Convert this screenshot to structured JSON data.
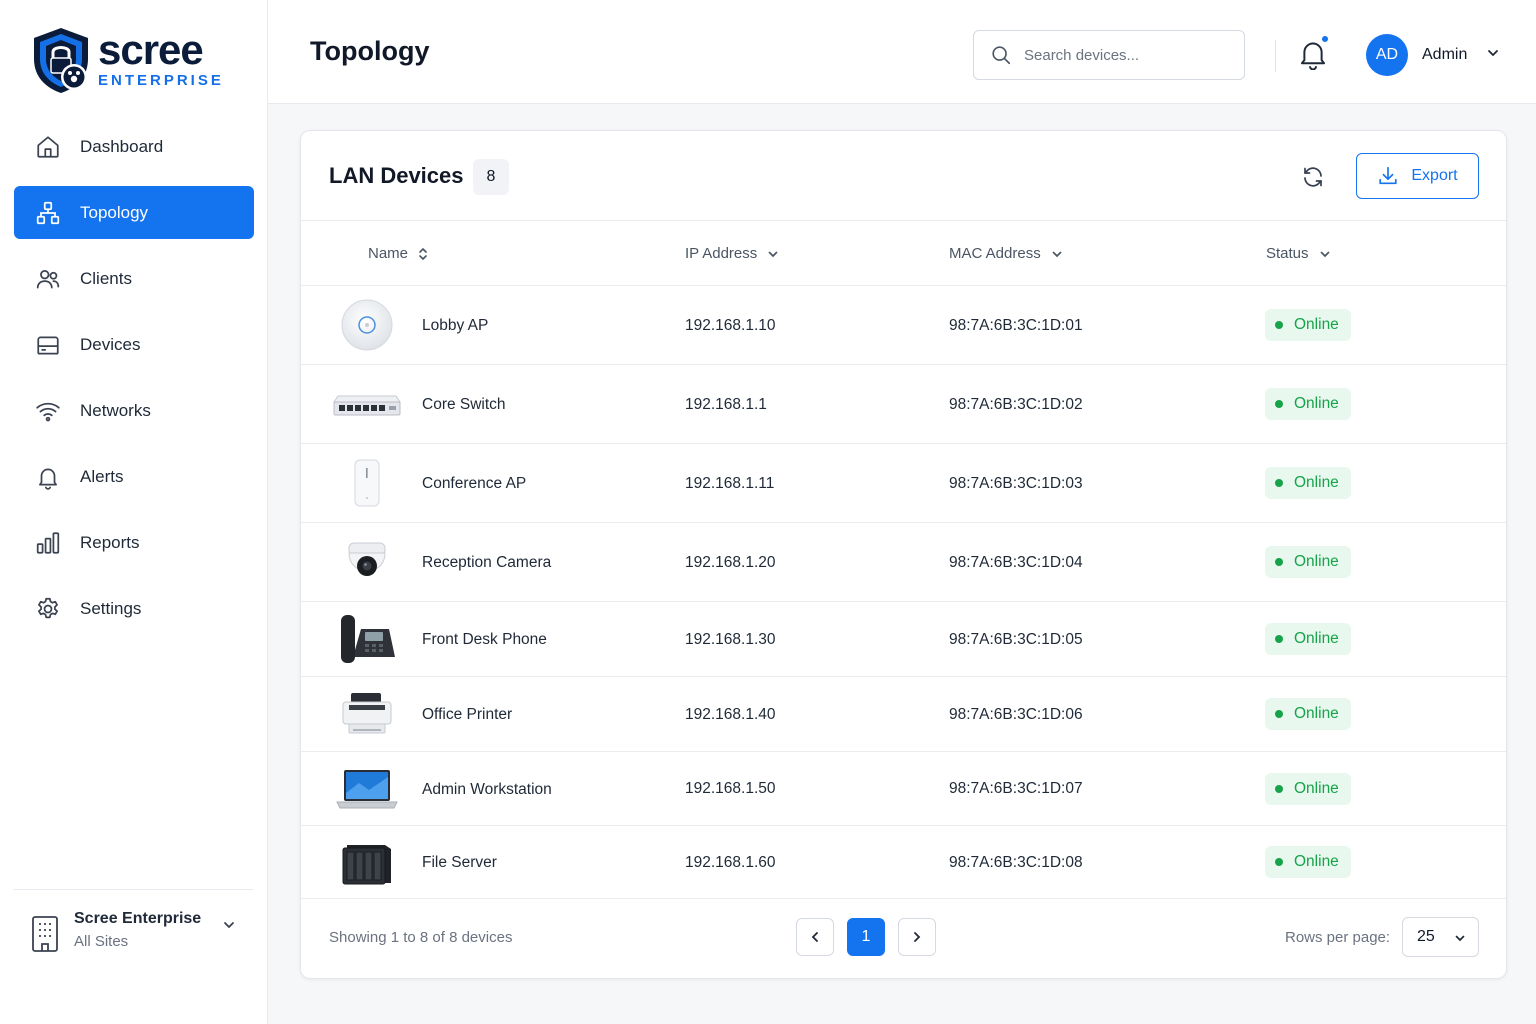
{
  "brand": {
    "name": "scree",
    "sub": "ENTERPRISE",
    "logo_icon": "shield-lock-icon"
  },
  "sidebar": {
    "items": [
      {
        "label": "Dashboard",
        "icon": "home-icon",
        "active": false
      },
      {
        "label": "Topology",
        "icon": "topology-icon",
        "active": true
      },
      {
        "label": "Clients",
        "icon": "users-icon",
        "active": false
      },
      {
        "label": "Devices",
        "icon": "hard-drive-icon",
        "active": false
      },
      {
        "label": "Networks",
        "icon": "wifi-icon",
        "active": false
      },
      {
        "label": "Alerts",
        "icon": "bell-icon",
        "active": false
      },
      {
        "label": "Reports",
        "icon": "bar-chart-icon",
        "active": false
      },
      {
        "label": "Settings",
        "icon": "gear-icon",
        "active": false
      }
    ],
    "org": {
      "name": "Scree Enterprise",
      "sub": "All Sites",
      "icon": "building-icon"
    }
  },
  "header": {
    "title": "Topology",
    "search_placeholder": "Search devices...",
    "notification_dot": true,
    "user": {
      "initials": "AD",
      "name": "Admin"
    }
  },
  "card": {
    "title": "LAN Devices",
    "count": "8",
    "export_label": "Export",
    "columns": {
      "name": "Name",
      "ip": "IP Address",
      "mac": "MAC Address",
      "status": "Status"
    },
    "rows": [
      {
        "name": "Lobby AP",
        "ip": "192.168.1.10",
        "mac": "98:7A:6B:3C:1D:01",
        "status": "Online",
        "icon": "access-point-disc-icon"
      },
      {
        "name": "Core Switch",
        "ip": "192.168.1.1",
        "mac": "98:7A:6B:3C:1D:02",
        "status": "Online",
        "icon": "network-switch-icon"
      },
      {
        "name": "Conference AP",
        "ip": "192.168.1.11",
        "mac": "98:7A:6B:3C:1D:03",
        "status": "Online",
        "icon": "access-point-tower-icon"
      },
      {
        "name": "Reception Camera",
        "ip": "192.168.1.20",
        "mac": "98:7A:6B:3C:1D:04",
        "status": "Online",
        "icon": "dome-camera-icon"
      },
      {
        "name": "Front Desk Phone",
        "ip": "192.168.1.30",
        "mac": "98:7A:6B:3C:1D:05",
        "status": "Online",
        "icon": "desk-phone-icon"
      },
      {
        "name": "Office Printer",
        "ip": "192.168.1.40",
        "mac": "98:7A:6B:3C:1D:06",
        "status": "Online",
        "icon": "printer-icon"
      },
      {
        "name": "Admin Workstation",
        "ip": "192.168.1.50",
        "mac": "98:7A:6B:3C:1D:07",
        "status": "Online",
        "icon": "laptop-icon"
      },
      {
        "name": "File Server",
        "ip": "192.168.1.60",
        "mac": "98:7A:6B:3C:1D:08",
        "status": "Online",
        "icon": "nas-server-icon"
      }
    ],
    "footer": {
      "showing": "Showing 1 to 8 of 8 devices",
      "current_page": "1",
      "rows_label": "Rows per page:",
      "rows_value": "25"
    }
  },
  "colors": {
    "accent": "#1473ef",
    "online": "#16a34a",
    "online_bg": "#e9f8ee"
  }
}
